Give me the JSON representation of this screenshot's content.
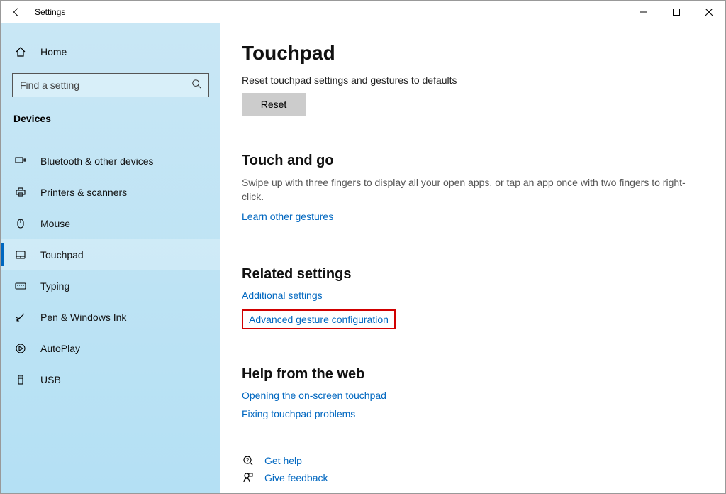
{
  "window": {
    "title": "Settings"
  },
  "sidebar": {
    "home_label": "Home",
    "search_placeholder": "Find a setting",
    "category": "Devices",
    "items": [
      {
        "label": "Bluetooth & other devices"
      },
      {
        "label": "Printers & scanners"
      },
      {
        "label": "Mouse"
      },
      {
        "label": "Touchpad"
      },
      {
        "label": "Typing"
      },
      {
        "label": "Pen & Windows Ink"
      },
      {
        "label": "AutoPlay"
      },
      {
        "label": "USB"
      }
    ]
  },
  "page": {
    "title": "Touchpad",
    "reset_desc": "Reset touchpad settings and gestures to defaults",
    "reset_button": "Reset",
    "touch_and_go": {
      "heading": "Touch and go",
      "body": "Swipe up with three fingers to display all your open apps, or tap an app once with two fingers to right-click.",
      "link": "Learn other gestures"
    },
    "related": {
      "heading": "Related settings",
      "link1": "Additional settings",
      "link2": "Advanced gesture configuration"
    },
    "help_web": {
      "heading": "Help from the web",
      "link1": "Opening the on-screen touchpad",
      "link2": "Fixing touchpad problems"
    },
    "footer": {
      "get_help": "Get help",
      "give_feedback": "Give feedback"
    }
  }
}
